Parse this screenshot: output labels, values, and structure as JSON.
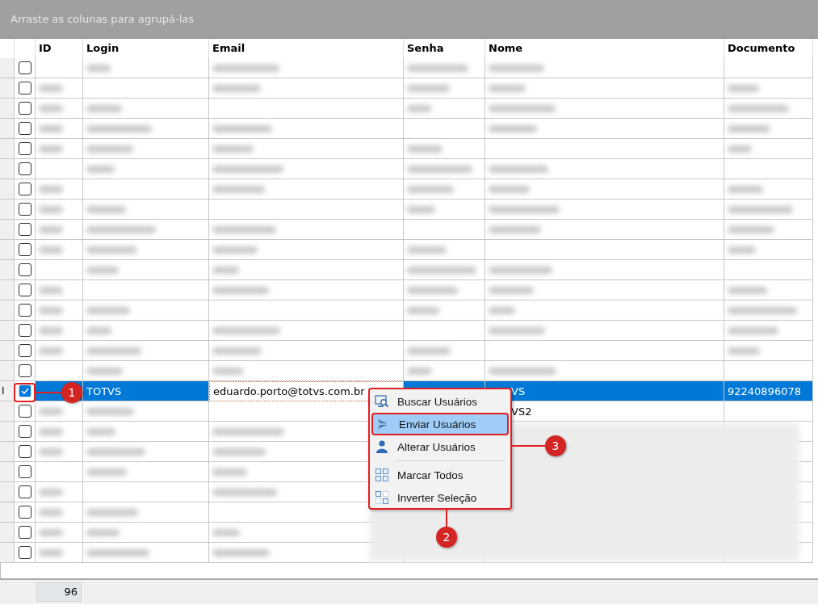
{
  "group_bar": {
    "text": "Arraste as colunas para agrupá-las"
  },
  "columns": [
    "ID",
    "Login",
    "Email",
    "Senha",
    "Nome",
    "Documento"
  ],
  "rows": [
    {
      "checked": false,
      "selected": false
    },
    {
      "checked": false,
      "selected": false
    },
    {
      "checked": false,
      "selected": false
    },
    {
      "checked": false,
      "selected": false
    },
    {
      "checked": false,
      "selected": false
    },
    {
      "checked": false,
      "selected": false
    },
    {
      "checked": false,
      "selected": false
    },
    {
      "checked": false,
      "selected": false
    },
    {
      "checked": false,
      "selected": false
    },
    {
      "checked": false,
      "selected": false
    },
    {
      "checked": false,
      "selected": false
    },
    {
      "checked": false,
      "selected": false
    },
    {
      "checked": false,
      "selected": false
    },
    {
      "checked": false,
      "selected": false
    },
    {
      "checked": false,
      "selected": false
    },
    {
      "checked": false,
      "selected": false
    },
    {
      "checked": true,
      "selected": true,
      "indicator": "I",
      "login": "TOTVS",
      "email": "eduardo.porto@totvs.com.br",
      "nome": "VS",
      "documento": "92240896078"
    },
    {
      "checked": false,
      "selected": false,
      "nome": "VS2"
    },
    {
      "checked": false,
      "selected": false
    },
    {
      "checked": false,
      "selected": false
    },
    {
      "checked": false,
      "selected": false
    },
    {
      "checked": false,
      "selected": false
    },
    {
      "checked": false,
      "selected": false
    },
    {
      "checked": false,
      "selected": false
    },
    {
      "checked": false,
      "selected": false
    }
  ],
  "context_menu": [
    {
      "kind": "search",
      "label": "Buscar Usuários",
      "selected": false
    },
    {
      "kind": "send",
      "label": "Enviar Usuários",
      "selected": true
    },
    {
      "kind": "user",
      "label": "Alterar Usuários",
      "selected": false
    },
    {
      "kind": "separator"
    },
    {
      "kind": "grid",
      "label": "Marcar Todos",
      "selected": false
    },
    {
      "kind": "invert",
      "label": "Inverter Seleção",
      "selected": false
    }
  ],
  "annotations": [
    {
      "label": "1"
    },
    {
      "label": "2"
    },
    {
      "label": "3"
    }
  ],
  "footer": {
    "count": "96"
  }
}
